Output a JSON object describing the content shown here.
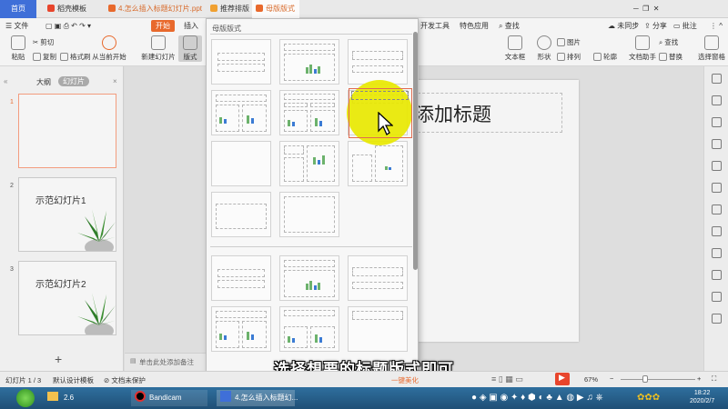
{
  "titlebar": {
    "tabs": [
      {
        "label": "首页",
        "active": true
      },
      {
        "label": "稻壳模板"
      },
      {
        "label": "4.怎么插入标题幻灯片.ppt"
      },
      {
        "label": "推荐排版"
      },
      {
        "label": "母版版式"
      }
    ],
    "right": {
      "sync": "未同步",
      "share": "分享",
      "annotate": "批注"
    }
  },
  "menu": {
    "file": "文件",
    "start": "开始",
    "insert": "插入",
    "devtools": "开发工具",
    "features": "特色应用",
    "search": "查找"
  },
  "toolbar": {
    "paste": "粘贴",
    "cut": "剪切",
    "copy": "复制",
    "format_painter": "格式刷",
    "from_current": "从当前开始",
    "new_slide": "新建幻灯片",
    "layout": "版式",
    "textbox": "文本框",
    "shape": "形状",
    "arrange": "排列",
    "picture": "图片",
    "outline": "轮廓",
    "find": "查找",
    "replace": "替换",
    "doc_helper": "文档助手",
    "select_pane": "选择窗格"
  },
  "left_panel": {
    "tab_outline": "大纲",
    "tab_slides": "幻灯片",
    "slides": [
      {
        "num": "1",
        "title": ""
      },
      {
        "num": "2",
        "title": "示范幻灯片1"
      },
      {
        "num": "3",
        "title": "示范幻灯片2"
      }
    ],
    "add_label": "+"
  },
  "dropdown": {
    "header": "母版版式"
  },
  "slide": {
    "title_placeholder": "添加标题"
  },
  "notes_placeholder": "单击此处添加备注",
  "statusbar": {
    "slide_count": "幻灯片 1 / 3",
    "design_template": "默认设计模板",
    "doc_protect": "文档未保护",
    "beautify": "一键美化",
    "zoom": "67%"
  },
  "taskbar": {
    "folder": "2.6",
    "bandicam": "Bandicam",
    "wps_title": "4.怎么插入标题幻...",
    "time": "18:22",
    "date": "2020/2/7"
  },
  "caption": "选择想要的标题版式即可",
  "colors": {
    "accent": "#e8692c",
    "highlight": "#e8e800",
    "selection": "#e06c50"
  }
}
